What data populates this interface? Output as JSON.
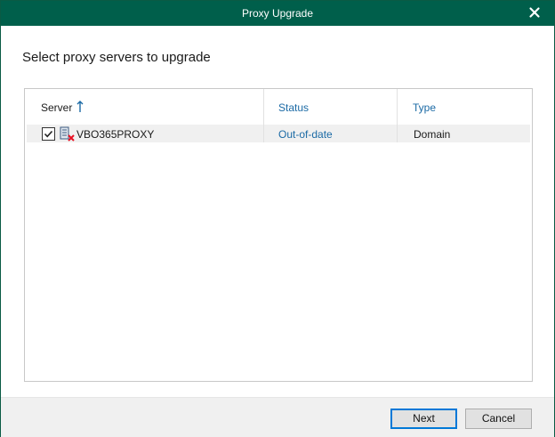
{
  "window": {
    "title": "Proxy Upgrade"
  },
  "heading": "Select proxy servers to upgrade",
  "table": {
    "columns": {
      "server": "Server",
      "status": "Status",
      "type": "Type"
    },
    "sort": {
      "column": "server",
      "direction": "ascending"
    },
    "rows": [
      {
        "checked": true,
        "server": "VBO365PROXY",
        "status": "Out-of-date",
        "type": "Domain",
        "icon": "server-error-icon"
      }
    ]
  },
  "buttons": {
    "next": "Next",
    "cancel": "Cancel"
  },
  "colors": {
    "titlebar": "#005f4b",
    "link": "#1b6aa5",
    "error": "#e81123"
  }
}
